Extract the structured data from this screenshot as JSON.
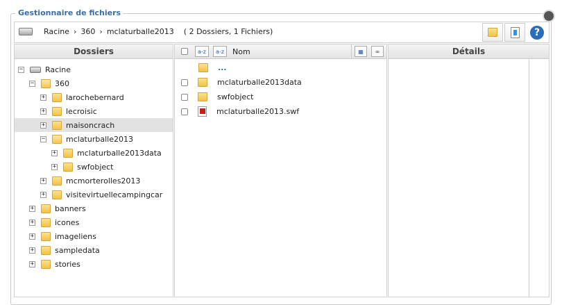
{
  "legend": "Gestionnaire de fichiers",
  "path": {
    "root": "Racine",
    "sep": "›",
    "seg1": "360",
    "seg2": "mclaturballe2013",
    "summary": "( 2 Dossiers, 1 Fichiers)"
  },
  "toolbar": {
    "new_folder_icon": "folder-add-icon",
    "upload_icon": "upload-icon",
    "help_label": "?"
  },
  "panels": {
    "folders": "Dossiers",
    "details": "Détails"
  },
  "tree": {
    "root": "Racine",
    "n360": "360",
    "larochebernard": "larochebernard",
    "lecroisic": "lecroisic",
    "maisoncrach": "maisoncrach",
    "mclaturballe2013": "mclaturballe2013",
    "mclaturballe2013data": "mclaturballe2013data",
    "swfobject": "swfobject",
    "mcmorterolles2013": "mcmorterolles2013",
    "visitevirtuellecampingcar": "visitevirtuellecampingcar",
    "banners": "banners",
    "icones": "icones",
    "imageliens": "imageliens",
    "sampledata": "sampledata",
    "stories": "stories"
  },
  "list": {
    "col_name": "Nom",
    "sort_a": "a-z",
    "sort_b": "a-z",
    "up": "...",
    "f1": "mclaturballe2013data",
    "f2": "swfobject",
    "f3": "mclaturballe2013.swf"
  }
}
